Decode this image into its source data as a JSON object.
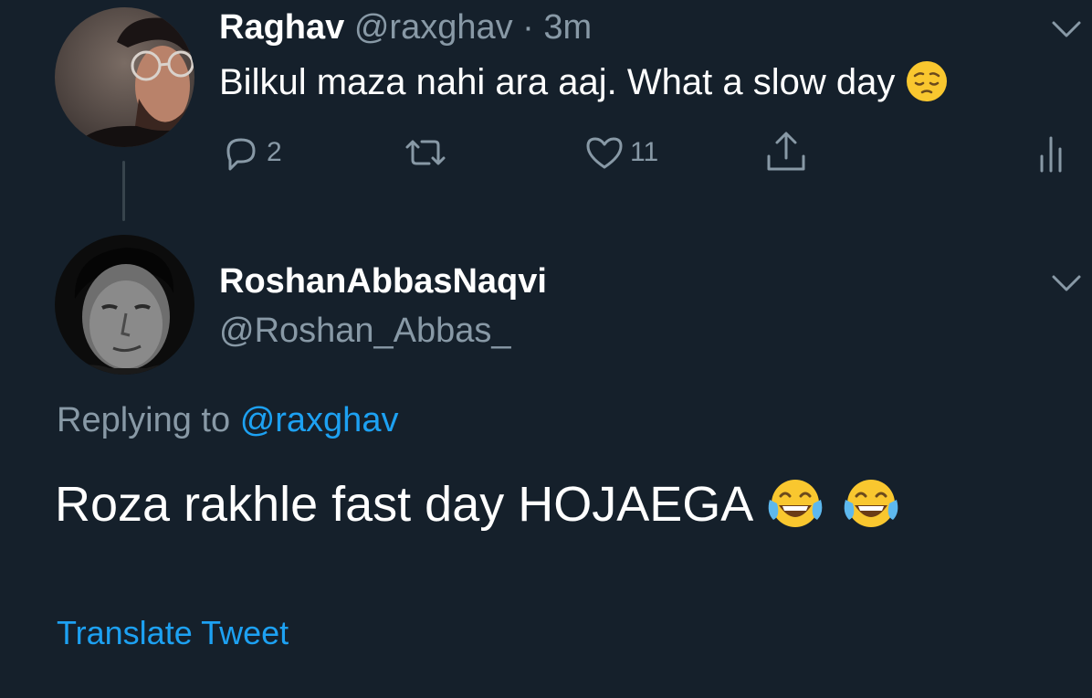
{
  "parent_tweet": {
    "display_name": "Raghav",
    "handle": "@raxghav",
    "separator": "·",
    "time": "3m",
    "text": "Bilkul maza nahi ara aaj. What a slow day",
    "emoji": "pensive-face",
    "actions": {
      "reply_count": "2",
      "retweet_count": "",
      "like_count": "11"
    }
  },
  "reply_tweet": {
    "display_name": "RoshanAbbasNaqvi",
    "handle": "@Roshan_Abbas_",
    "replying_prefix": "Replying to",
    "replying_to": "@raxghav",
    "text": "Roza rakhle fast day HOJAEGA",
    "emojis": [
      "face-with-tears-of-joy",
      "face-with-tears-of-joy"
    ],
    "translate_label": "Translate Tweet"
  },
  "colors": {
    "background": "#15202b",
    "text": "#ffffff",
    "muted": "#8899a6",
    "accent": "#1da1f2",
    "thread_line": "#38444d"
  }
}
